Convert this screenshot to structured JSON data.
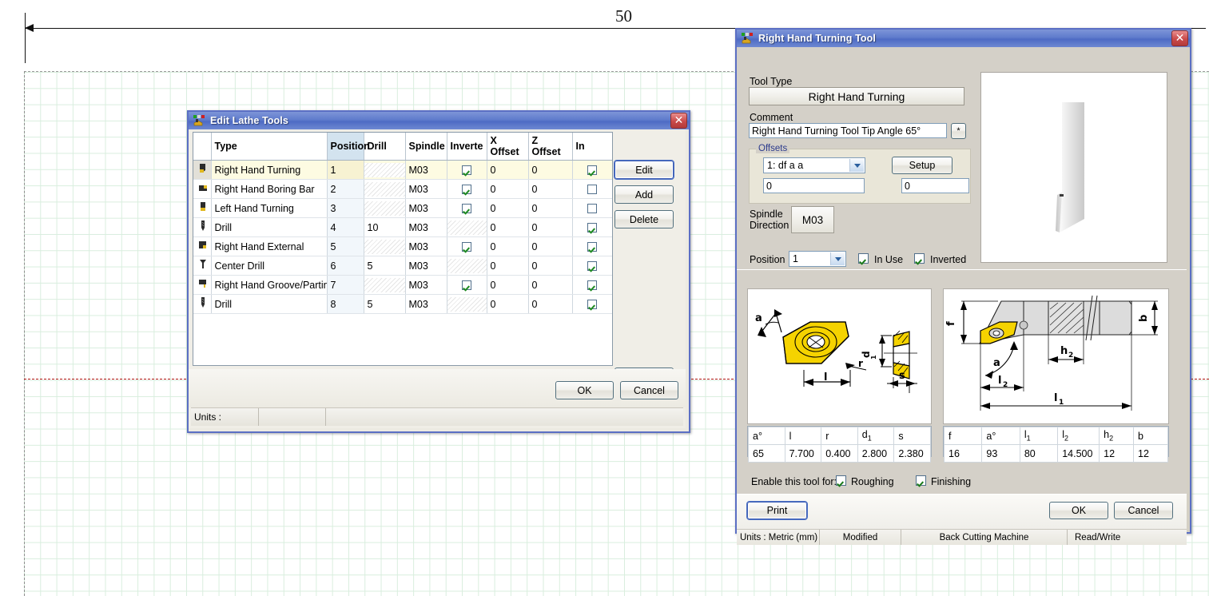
{
  "cad": {
    "dimension_label": "50",
    "grid_color": "#d9eede",
    "centerline_color": "#b51515"
  },
  "edit_lathe_tools": {
    "title": "Edit Lathe Tools",
    "icon": "lathe-tool-icon",
    "close_label": "✕",
    "columns": [
      "",
      "Type",
      "Position",
      "Drill",
      "Spindle",
      "Inverte",
      "X Offset",
      "Z Offset",
      "In"
    ],
    "rows": [
      {
        "icon": "right-hand-turning-icon",
        "type": "Right Hand Turning",
        "position": "1",
        "drill": "",
        "spindle": "M03",
        "inverted": "checked",
        "x_offset": "0",
        "z_offset": "0",
        "in_use": "checked",
        "selected": true
      },
      {
        "icon": "right-hand-boring-bar-icon",
        "type": "Right Hand Boring Bar",
        "position": "2",
        "drill": "",
        "spindle": "M03",
        "inverted": "checked",
        "x_offset": "0",
        "z_offset": "0",
        "in_use": "unchecked",
        "selected": false
      },
      {
        "icon": "left-hand-turning-icon",
        "type": "Left Hand Turning",
        "position": "3",
        "drill": "",
        "spindle": "M03",
        "inverted": "checked",
        "x_offset": "0",
        "z_offset": "0",
        "in_use": "unchecked",
        "selected": false
      },
      {
        "icon": "drill-icon",
        "type": "Drill",
        "position": "4",
        "drill": "10",
        "spindle": "M03",
        "inverted": "disabled",
        "x_offset": "0",
        "z_offset": "0",
        "in_use": "checked",
        "selected": false
      },
      {
        "icon": "right-hand-external-icon",
        "type": "Right Hand External",
        "position": "5",
        "drill": "",
        "spindle": "M03",
        "inverted": "checked",
        "x_offset": "0",
        "z_offset": "0",
        "in_use": "checked",
        "selected": false
      },
      {
        "icon": "center-drill-icon",
        "type": "Center Drill",
        "position": "6",
        "drill": "5",
        "spindle": "M03",
        "inverted": "disabled",
        "x_offset": "0",
        "z_offset": "0",
        "in_use": "checked",
        "selected": false
      },
      {
        "icon": "right-hand-groove-parting-icon",
        "type": "Right Hand Groove/Parting",
        "position": "7",
        "drill": "",
        "spindle": "M03",
        "inverted": "checked",
        "x_offset": "0",
        "z_offset": "0",
        "in_use": "checked",
        "selected": false
      },
      {
        "icon": "drill-icon",
        "type": "Drill",
        "position": "8",
        "drill": "5",
        "spindle": "M03",
        "inverted": "disabled",
        "x_offset": "0",
        "z_offset": "0",
        "in_use": "checked",
        "selected": false
      }
    ],
    "buttons": {
      "edit": "Edit",
      "add": "Add",
      "delete": "Delete",
      "print": "Print",
      "ok": "OK",
      "cancel": "Cancel"
    },
    "status": {
      "units": "Units :",
      "cell2": "",
      "cell3": ""
    }
  },
  "right_hand_turning_tool": {
    "title": "Right Hand Turning Tool",
    "icon": "lathe-tool-icon",
    "close_label": "✕",
    "tool_type_label": "Tool Type",
    "tool_type_value": "Right Hand Turning",
    "comment_label": "Comment",
    "comment_value": "Right Hand Turning Tool Tip Angle 65°",
    "comment_button_label": "*",
    "offsets": {
      "legend": "Offsets",
      "select_value": "1: df a a",
      "setup_label": "Setup",
      "x_value": "0",
      "z_value": "0"
    },
    "spindle_direction_label": "Spindle Direction",
    "spindle_direction_value": "M03",
    "position_label": "Position",
    "position_value": "1",
    "in_use_label": "In Use",
    "in_use_checked": true,
    "inverted_label": "Inverted",
    "inverted_checked": true,
    "insert_dims": {
      "headers": [
        "a°",
        "l",
        "r",
        "d1",
        "s"
      ],
      "values": [
        "65",
        "7.700",
        "0.400",
        "2.800",
        "2.380"
      ]
    },
    "holder_dims": {
      "headers": [
        "f",
        "a°",
        "l1",
        "l2",
        "h2",
        "b"
      ],
      "values": [
        "16",
        "93",
        "80",
        "14.500",
        "12",
        "12"
      ]
    },
    "enable_label": "Enable this tool for:",
    "roughing_label": "Roughing",
    "roughing_checked": true,
    "finishing_label": "Finishing",
    "finishing_checked": true,
    "buttons": {
      "print": "Print",
      "ok": "OK",
      "cancel": "Cancel"
    },
    "status": {
      "units": "Units : Metric (mm)",
      "modified": "Modified",
      "machine": "Back Cutting Machine",
      "access": "Read/Write"
    }
  }
}
